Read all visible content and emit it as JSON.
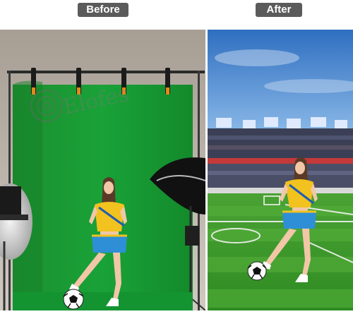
{
  "labels": {
    "before": "Before",
    "after": "After"
  },
  "watermark": "Elofes",
  "colors": {
    "label_bg": "#5b5b5b",
    "backdrop_green": "#169a33",
    "studio_wall": "#bcb5ac",
    "sky": "#3a7ac6",
    "pitch": "#3f9a2c",
    "jersey": "#f2c21e",
    "shorts": "#2f8fd6"
  }
}
